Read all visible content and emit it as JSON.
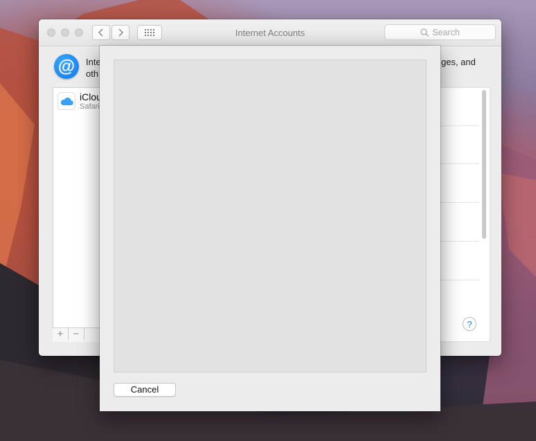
{
  "window": {
    "title": "Internet Accounts",
    "search_placeholder": "Search"
  },
  "header": {
    "description_line1_left": "Inte",
    "description_line1_right": "ges, and",
    "description_line2_left": "oth"
  },
  "accounts": [
    {
      "name": "iClou",
      "subtitle": "Safari"
    }
  ],
  "list_controls": {
    "add_label": "+",
    "remove_label": "−"
  },
  "help_label": "?",
  "sheet": {
    "cancel_label": "Cancel"
  },
  "icons": [
    "back-chevron-icon",
    "forward-chevron-icon",
    "grid-icon",
    "search-icon",
    "at-icon",
    "icloud-icon"
  ],
  "colors": {
    "accent": "#1a82f1",
    "window_bg": "#ececec"
  }
}
